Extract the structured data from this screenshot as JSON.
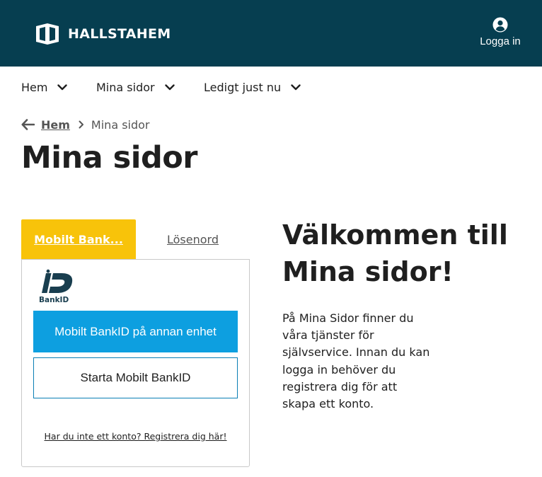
{
  "header": {
    "brand": "HALLSTAHEM",
    "login_label": "Logga in",
    "background_color": "#063e50",
    "icons": {
      "logo": "hallstahem-logo-icon",
      "login": "user-circle-icon"
    }
  },
  "nav": {
    "items": [
      {
        "label": "Hem",
        "icon": "chevron-down-icon"
      },
      {
        "label": "Mina sidor",
        "icon": "chevron-down-icon"
      },
      {
        "label": "Ledigt just nu",
        "icon": "chevron-down-icon"
      }
    ]
  },
  "breadcrumb": {
    "back_icon": "arrow-left-icon",
    "link": "Hem",
    "separator_icon": "chevron-right-icon",
    "current": "Mina sidor"
  },
  "page": {
    "title": "Mina sidor"
  },
  "login_panel": {
    "tabs": [
      {
        "label": "Mobilt Bank...",
        "active": true
      },
      {
        "label": "Lösenord",
        "active": false
      }
    ],
    "bankid_logo_text": "BankID",
    "primary_button": "Mobilt BankID på annan enhet",
    "secondary_button": "Starta Mobilt BankID",
    "register_link": "Har du inte ett konto? Registrera dig här!",
    "colors": {
      "active_tab": "#f8c30a",
      "primary_button": "#0d9fe0",
      "secondary_border": "#0a7fb5"
    }
  },
  "welcome": {
    "title_line1": "Välkommen till",
    "title_line2": "Mina sidor!",
    "text": "På Mina Sidor finner du våra tjänster för självservice. Innan du kan logga in behöver du registrera dig för att skapa ett konto."
  }
}
